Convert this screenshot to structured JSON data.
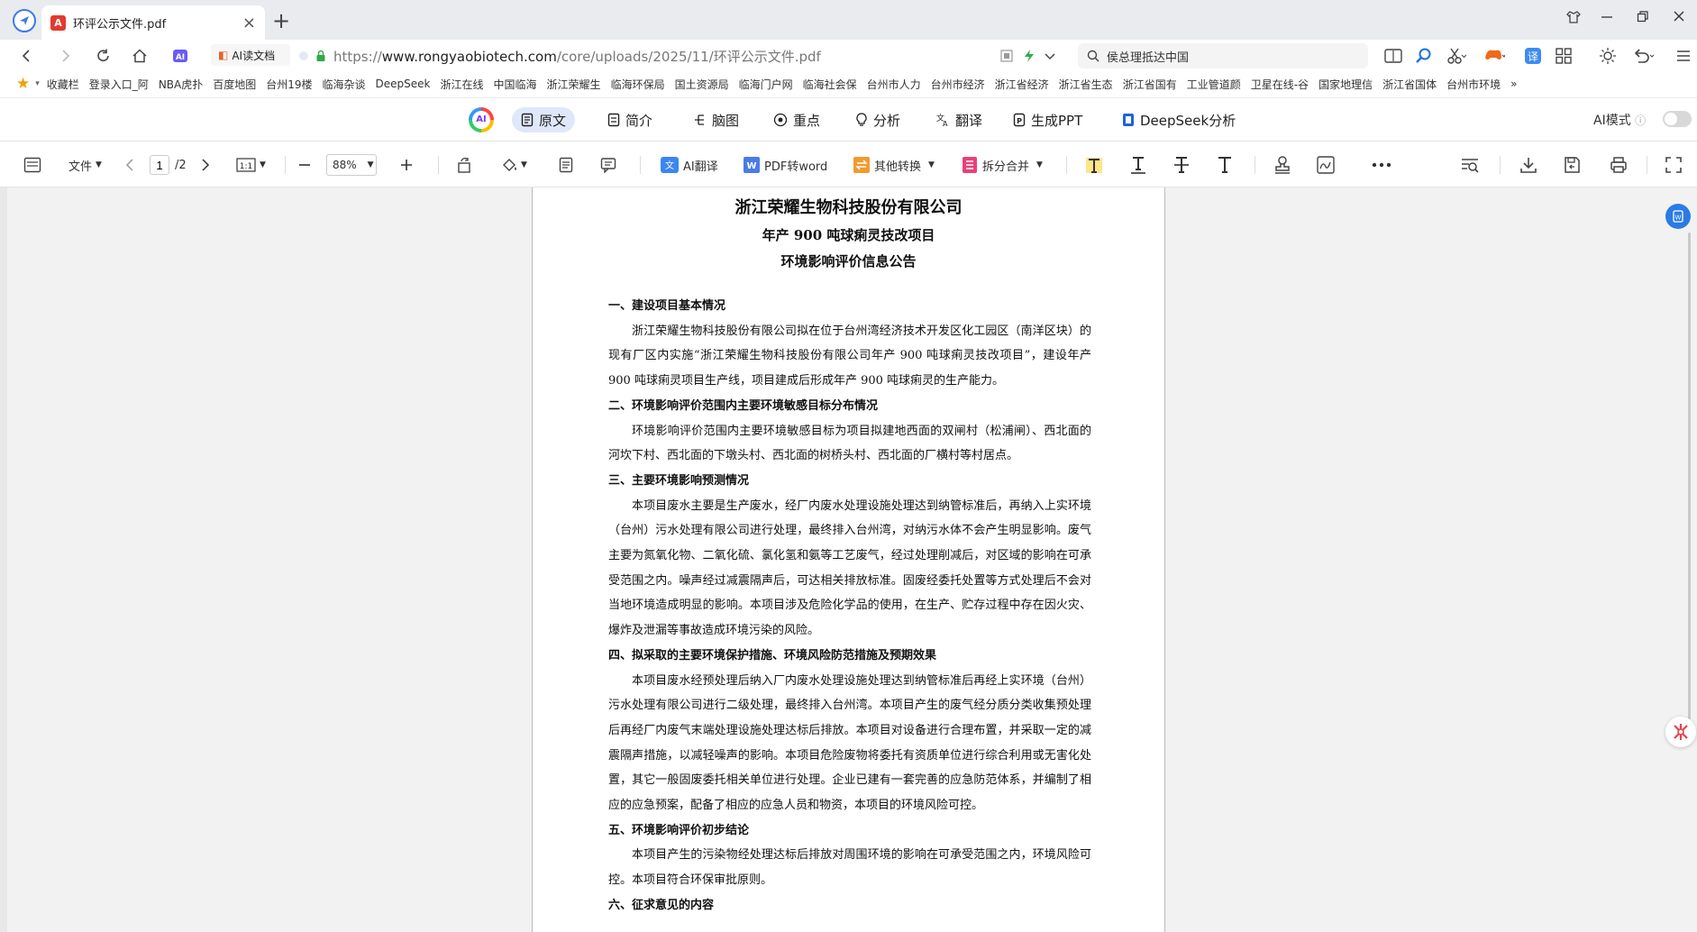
{
  "tab": {
    "title": "环评公示文件.pdf",
    "close": "×",
    "new": "+"
  },
  "address": {
    "ai_pill": "AI读文档",
    "url_prefix": "https://",
    "url_host": "www.rongyaobiotech.com",
    "url_path": "/core/uploads/2025/11/环评公示文件.pdf",
    "search": "侯总理抵达中国"
  },
  "bookmarks": [
    "收藏栏",
    "登录入口_阿",
    "NBA虎扑",
    "百度地图",
    "台州19楼",
    "临海杂谈",
    "DeepSeek",
    "浙江在线",
    "中国临海",
    "浙江荣耀生",
    "临海环保局",
    "国土资源局",
    "临海门户网",
    "临海社会保",
    "台州市人力",
    "台州市经济",
    "浙江省经济",
    "浙江省生态",
    "浙江省国有",
    "工业管道颜",
    "卫星在线-谷",
    "国家地理信",
    "浙江省国体",
    "台州市环境",
    "»"
  ],
  "ai_toolbar": {
    "tabs": [
      "原文",
      "简介",
      "脑图",
      "重点",
      "分析",
      "翻译",
      "生成PPT",
      "DeepSeek分析"
    ],
    "mode_label": "AI模式"
  },
  "pdf_toolbar": {
    "file": "文件",
    "page_current": "1",
    "page_total": "/2",
    "zoom": "88%",
    "ai_translate": "AI翻译",
    "pdf_word": "PDF转word",
    "other_convert": "其他转换",
    "split_merge": "拆分合并"
  },
  "document": {
    "title1": "浙江荣耀生物科技股份有限公司",
    "title2": "年产 900 吨球痢灵技改项目",
    "title3": "环境影响评价信息公告",
    "sections": [
      {
        "head": "一、建设项目基本情况",
        "para": "浙江荣耀生物科技股份有限公司拟在位于台州湾经济技术开发区化工园区（南洋区块）的现有厂区内实施“浙江荣耀生物科技股份有限公司年产 900 吨球痢灵技改项目”，建设年产 900 吨球痢灵项目生产线，项目建成后形成年产 900 吨球痢灵的生产能力。"
      },
      {
        "head": "二、环境影响评价范围内主要环境敏感目标分布情况",
        "para": "环境影响评价范围内主要环境敏感目标为项目拟建地西面的双闸村（松浦闸）、西北面的河坎下村、西北面的下墩头村、西北面的树桥头村、西北面的厂横村等村居点。"
      },
      {
        "head": "三、主要环境影响预测情况",
        "para": "本项目废水主要是生产废水，经厂内废水处理设施处理达到纳管标准后，再纳入上实环境（台州）污水处理有限公司进行处理，最终排入台州湾，对纳污水体不会产生明显影响。废气主要为氮氧化物、二氧化硫、氯化氢和氨等工艺废气，经过处理削减后，对区域的影响在可承受范围之内。噪声经过减震隔声后，可达相关排放标准。固废经委托处置等方式处理后不会对当地环境造成明显的影响。本项目涉及危险化学品的使用，在生产、贮存过程中存在因火灾、爆炸及泄漏等事故造成环境污染的风险。"
      },
      {
        "head": "四、拟采取的主要环境保护措施、环境风险防范措施及预期效果",
        "para": "本项目废水经预处理后纳入厂内废水处理设施处理达到纳管标准后再经上实环境（台州）污水处理有限公司进行二级处理，最终排入台州湾。本项目产生的废气经分质分类收集预处理后再经厂内废气末端处理设施处理达标后排放。本项目对设备进行合理布置，并采取一定的减震隔声措施，以减轻噪声的影响。本项目危险废物将委托有资质单位进行综合利用或无害化处置，其它一般固废委托相关单位进行处理。企业已建有一套完善的应急防范体系，并编制了相应的应急预案，配备了相应的应急人员和物资，本项目的环境风险可控。"
      },
      {
        "head": "五、环境影响评价初步结论",
        "para": "本项目产生的污染物经处理达标后排放对周围环境的影响在可承受范围之内，环境风险可控。本项目符合环保审批原则。"
      },
      {
        "head": "六、征求意见的内容",
        "para": ""
      }
    ]
  }
}
